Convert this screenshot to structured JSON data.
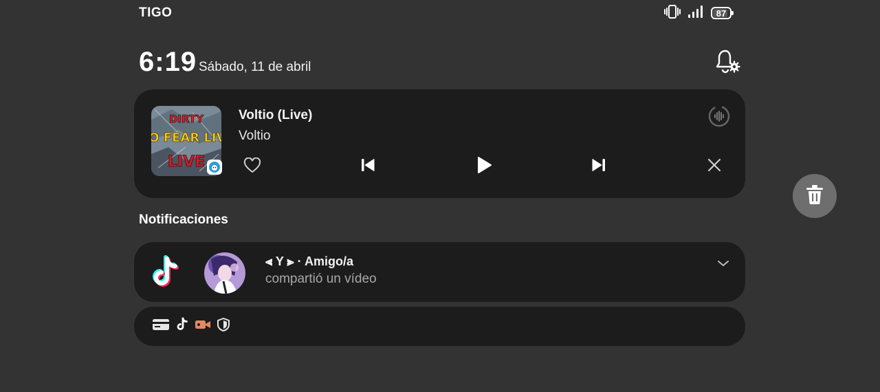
{
  "status_bar": {
    "carrier": "TIGO",
    "battery_level": "87",
    "icons": [
      "vibrate-icon",
      "signal-icon",
      "battery-icon"
    ]
  },
  "header": {
    "time": "6:19",
    "date": "Sábado, 11 de abril",
    "settings_icon": "bell-settings-icon"
  },
  "media_player": {
    "title": "Voltio (Live)",
    "artist": "Voltio",
    "album_art_text": "NO FEAR LIVE",
    "controls": [
      "heart-icon",
      "previous-icon",
      "play-icon",
      "next-icon",
      "close-icon"
    ],
    "output_icon": "audio-output-icon"
  },
  "notifications": {
    "section_title": "Notificaciones",
    "items": [
      {
        "app": "TikTok",
        "sender": "⫷ Y ⫸ · Amigo/a",
        "text": "compartió un vídeo",
        "expand_icon": "chevron-down-icon"
      }
    ],
    "silent_icons": [
      "card-icon",
      "tiktok-icon",
      "video-camera-icon",
      "shield-icon"
    ]
  },
  "trash_button": {
    "icon": "trash-icon"
  },
  "colors": {
    "background": "#333333",
    "card": "#1c1c1c",
    "trash_bg": "#6e6e6e",
    "tiktok_cyan": "#25f4ee",
    "tiktok_pink": "#fe2c55"
  }
}
